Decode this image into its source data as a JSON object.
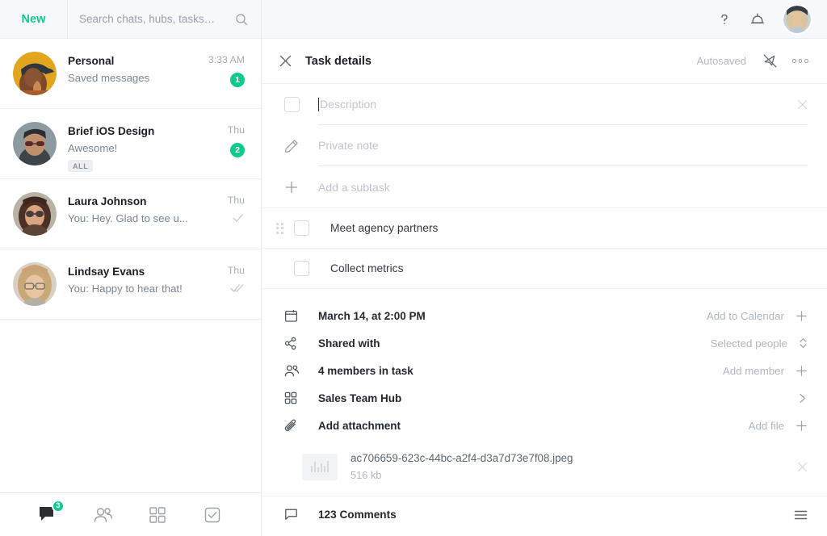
{
  "sidebar": {
    "new_button": "New",
    "search": {
      "placeholder": "Search chats, hubs, tasks…",
      "value": "",
      "icon": "search-icon"
    },
    "chats": [
      {
        "name": "Personal",
        "preview": "Saved messages",
        "time": "3:33 AM",
        "badge": "1",
        "tag": "",
        "tick": "",
        "avatar_color": "#e0a020"
      },
      {
        "name": "Brief iOS Design",
        "preview": "Awesome!",
        "time": "Thu",
        "badge": "2",
        "tag": "ALL",
        "tick": "",
        "avatar_color": "#6e7a80"
      },
      {
        "name": "Laura Johnson",
        "preview": "You: Hey. Glad to see u...",
        "time": "Thu",
        "badge": "",
        "tag": "",
        "tick": "single",
        "avatar_color": "#9a7f72"
      },
      {
        "name": "Lindsay Evans",
        "preview": "You: Happy to hear that!",
        "time": "Thu",
        "badge": "",
        "tag": "",
        "tick": "double",
        "avatar_color": "#c4a98c"
      }
    ],
    "bottom_nav": [
      {
        "icon": "chats-icon",
        "badge": "3",
        "active": true
      },
      {
        "icon": "contacts-icon",
        "badge": "",
        "active": false
      },
      {
        "icon": "hubs-grid-icon",
        "badge": "",
        "active": false
      },
      {
        "icon": "tasks-check-icon",
        "badge": "",
        "active": false
      }
    ]
  },
  "topbar": {
    "help_icon": "question-mark-icon",
    "notifications_icon": "bell-icon",
    "avatar": "user-avatar"
  },
  "task": {
    "header": {
      "close_icon": "close-icon",
      "title": "Task details",
      "autosaved": "Autosaved",
      "mute_icon": "notifications-off-icon",
      "more_icon": "more-options-icon"
    },
    "description": {
      "placeholder": "Description",
      "value": "",
      "checkbox_icon": "task-checkbox",
      "clear_icon": "clear-icon"
    },
    "private_note": {
      "placeholder": "Private note",
      "value": "",
      "icon": "pencil-icon"
    },
    "add_subtask": {
      "placeholder": "Add a subtask",
      "value": "",
      "icon": "plus-icon"
    },
    "subtasks": [
      {
        "label": "Meet agency partners",
        "checked": false,
        "draggable": true
      },
      {
        "label": "Collect metrics",
        "checked": false,
        "draggable": false
      }
    ],
    "meta_rows": [
      {
        "icon": "calendar-icon",
        "label": "March 14, at 2:00 PM",
        "action": "Add to Calendar",
        "control": "plus-icon"
      },
      {
        "icon": "share-nodes-icon",
        "label": "Shared with",
        "action": "Selected people",
        "control": "chevron-updown-icon"
      },
      {
        "icon": "members-icon",
        "label": "4 members in task",
        "action": "Add member",
        "control": "plus-icon"
      },
      {
        "icon": "hub-grid-icon",
        "label": "Sales Team Hub",
        "action": "",
        "control": "chevron-right-icon"
      },
      {
        "icon": "paperclip-icon",
        "label": "Add attachment",
        "action": "Add file",
        "control": "plus-icon"
      }
    ],
    "attachment": {
      "thumb_icon": "image-thumbnail",
      "name": "ac706659-623c-44bc-a2f4-d3a7d73e7f08.jpeg",
      "size": "516 kb",
      "remove_icon": "close-icon"
    },
    "comments": {
      "icon": "comment-bubble-icon",
      "label": "123 Comments",
      "menu_icon": "list-menu-icon"
    }
  },
  "colors": {
    "accent_green": "#0ecb8d",
    "text_primary": "#1b1f23",
    "text_muted": "#9aa1a9",
    "border": "#eef0f2",
    "topbar_bg": "#f7f8fa"
  }
}
